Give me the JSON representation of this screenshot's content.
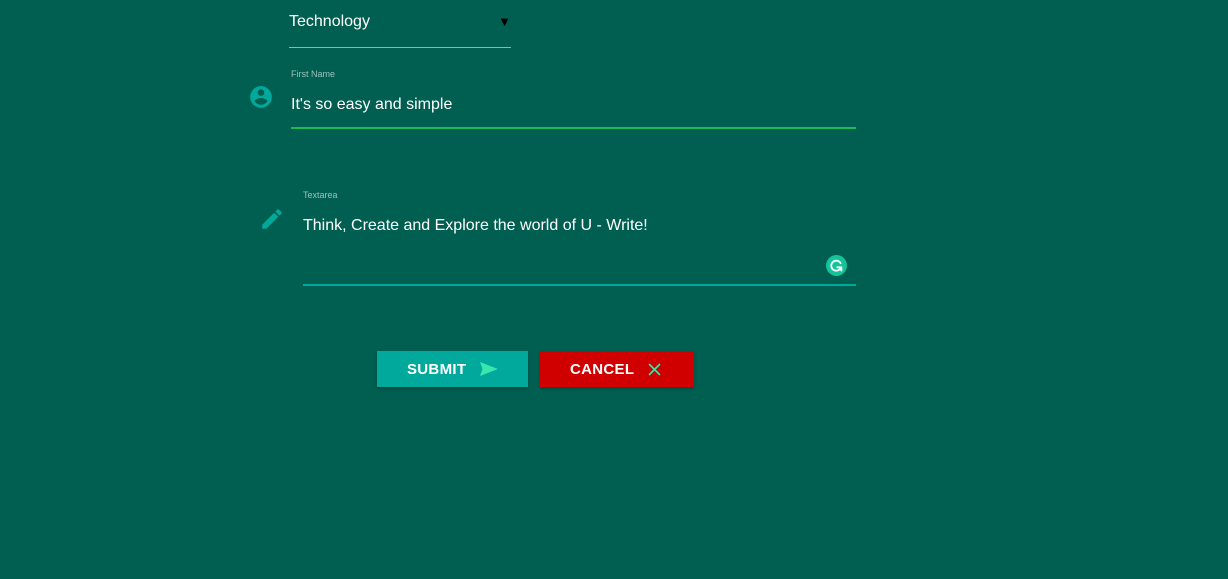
{
  "category_select": {
    "value": "Technology",
    "arrow": "▼"
  },
  "first_name": {
    "label": "First Name",
    "value": "It's so easy and simple",
    "icon": "account-circle-icon"
  },
  "textarea": {
    "label": "Textarea",
    "value": "Think, Create and Explore the world of U - Write!",
    "icon": "pencil-icon"
  },
  "buttons": {
    "submit_label": "SUBMIT",
    "submit_icon": "send-icon",
    "cancel_label": "CANCEL",
    "cancel_icon": "close-icon"
  },
  "colors": {
    "background": "#005f50",
    "accent_teal": "#00a99b",
    "focus_green": "#1db954",
    "cancel_red": "#d10000",
    "grammarly_green": "#15c39a"
  }
}
